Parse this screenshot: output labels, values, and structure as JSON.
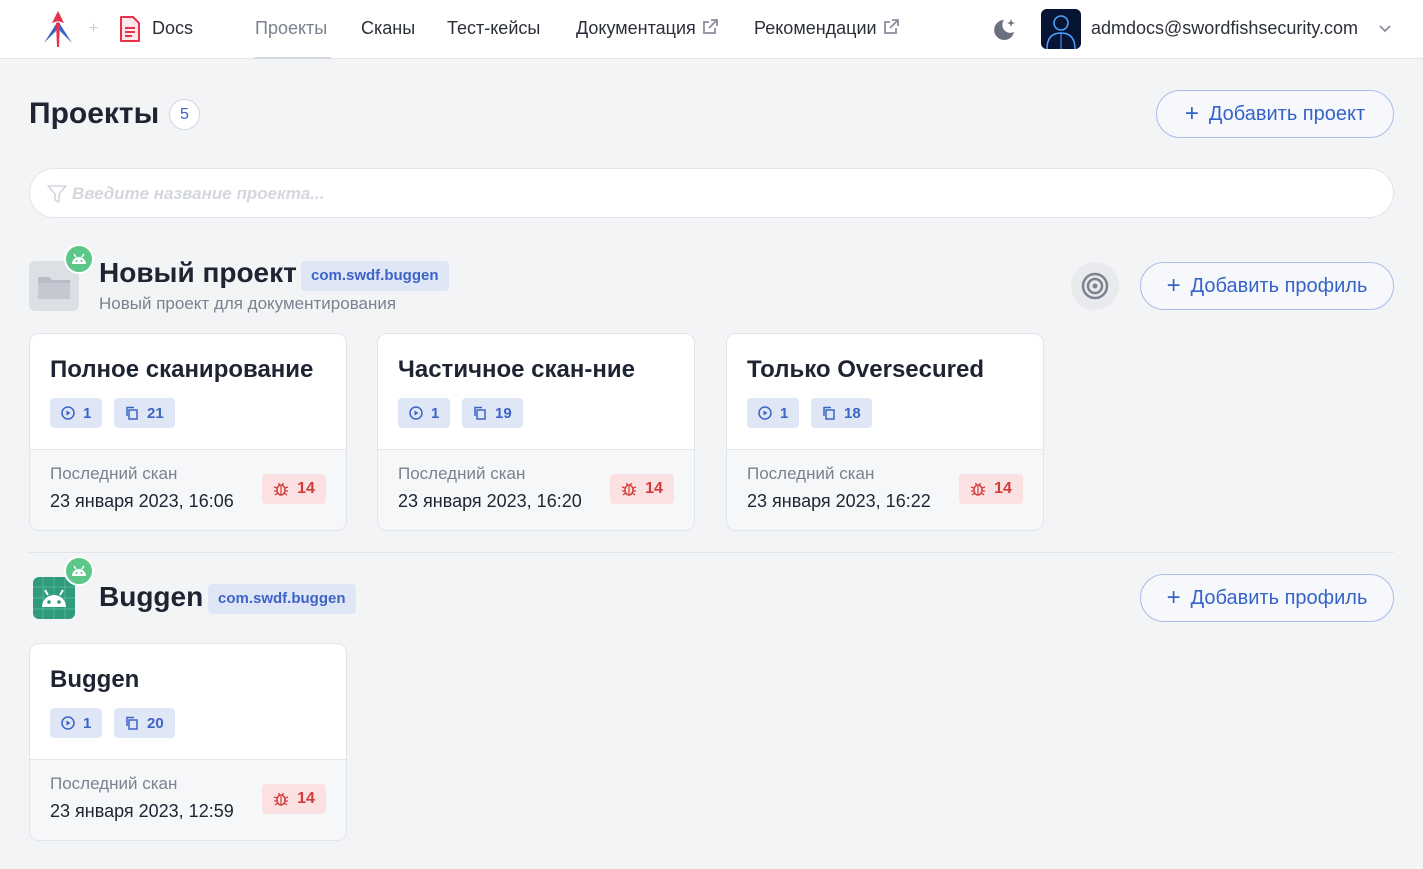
{
  "topbar": {
    "docs_label": "Docs",
    "nav": [
      {
        "label": "Проекты",
        "active": true
      },
      {
        "label": "Сканы"
      },
      {
        "label": "Тест-кейсы"
      },
      {
        "label": "Документация",
        "external": true
      },
      {
        "label": "Рекомендации",
        "external": true
      }
    ],
    "user_email": "admdocs@swordfishsecurity.com"
  },
  "page": {
    "title": "Проекты",
    "count": "5",
    "add_project_label": "Добавить проект",
    "search_placeholder": "Введите название проекта..."
  },
  "projects": [
    {
      "name": "Новый проект",
      "package": "com.swdf.buggen",
      "description": "Новый проект для документирования",
      "platform": "android",
      "add_profile_label": "Добавить профиль",
      "profiles": [
        {
          "name": "Полное сканирование",
          "scans": "1",
          "tests": "21",
          "last_scan_label": "Последний скан",
          "last_scan_date": "23 января 2023, 16:06",
          "bugs": "14"
        },
        {
          "name": "Частичное скан-ние",
          "scans": "1",
          "tests": "19",
          "last_scan_label": "Последний скан",
          "last_scan_date": "23 января 2023, 16:20",
          "bugs": "14"
        },
        {
          "name": "Только Oversecured",
          "scans": "1",
          "tests": "18",
          "last_scan_label": "Последний скан",
          "last_scan_date": "23 января 2023, 16:22",
          "bugs": "14"
        }
      ]
    },
    {
      "name": "Buggen",
      "package": "com.swdf.buggen",
      "platform": "android",
      "add_profile_label": "Добавить профиль",
      "profiles": [
        {
          "name": "Buggen",
          "scans": "1",
          "tests": "20",
          "last_scan_label": "Последний скан",
          "last_scan_date": "23 января 2023, 12:59",
          "bugs": "14"
        }
      ]
    }
  ],
  "colors": {
    "accent": "#3563c9",
    "bug": "#d23b3b",
    "android": "#5cc788"
  }
}
